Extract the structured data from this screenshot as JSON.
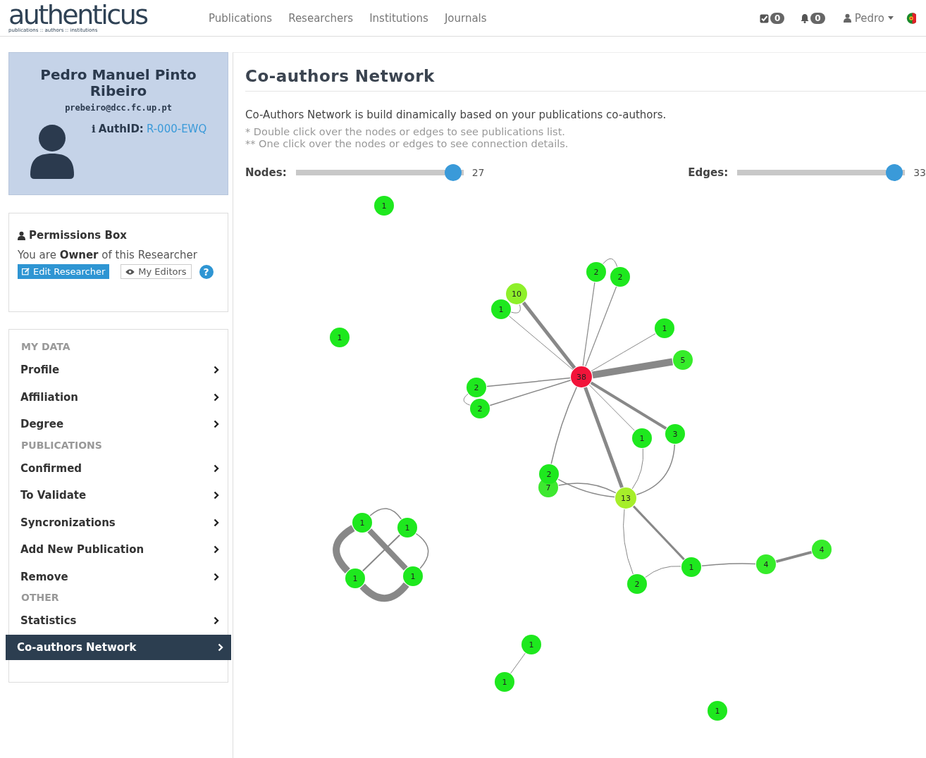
{
  "header": {
    "logo": "authenticus",
    "logo_tagline": "publications :: authors :: institutions",
    "nav": [
      {
        "label": "Publications"
      },
      {
        "label": "Researchers"
      },
      {
        "label": "Institutions"
      },
      {
        "label": "Journals"
      }
    ],
    "tasks_count": "0",
    "notifications_count": "0",
    "user": "Pedro"
  },
  "profile": {
    "name": "Pedro Manuel Pinto Ribeiro",
    "email": "prebeiro@dcc.fc.up.pt",
    "info_glyph": "i",
    "authid_label": "AuthID:",
    "authid": "R-000-EWQ"
  },
  "permissions": {
    "title": "Permissions Box",
    "text": "You are **Owner** of this Researcher",
    "edit_button": "Edit Researcher",
    "editors_button": "My Editors",
    "help": "?"
  },
  "menu": [
    {
      "title": "MY DATA",
      "items": [
        {
          "label": "Profile",
          "selected": false
        },
        {
          "label": "Affiliation",
          "selected": false
        },
        {
          "label": "Degree",
          "selected": false
        }
      ]
    },
    {
      "title": "PUBLICATIONS",
      "items": [
        {
          "label": "Confirmed",
          "selected": false
        },
        {
          "label": "To Validate",
          "selected": false
        },
        {
          "label": "Syncronizations",
          "selected": false
        },
        {
          "label": "Add New Publication",
          "selected": false
        },
        {
          "label": "Remove",
          "selected": false
        }
      ]
    },
    {
      "title": "OTHER",
      "items": [
        {
          "label": "Statistics",
          "selected": false
        },
        {
          "label": "Co-authors Network",
          "selected": true
        }
      ]
    }
  ],
  "main": {
    "title": "Co-authors Network",
    "description": "Co-Authors Network is build dinamically based on your publications co-authors.",
    "notes": [
      "* Double click over the nodes or edges to see publications list.",
      "** One click over the nodes or edges to see connection details."
    ],
    "sliders": [
      {
        "label": "Nodes:",
        "level": 0.96,
        "value": "27"
      },
      {
        "label": "Edges:",
        "level": 0.96,
        "value": "33"
      }
    ],
    "graph_nodes": [
      {
        "label": "1",
        "color": "#1ee81e"
      },
      {
        "label": "1",
        "color": "#1ee81e"
      },
      {
        "label": "10",
        "color": "#8ef02a"
      },
      {
        "label": "1",
        "color": "#1ee81e"
      },
      {
        "label": "2",
        "color": "#1ee81e"
      },
      {
        "label": "2",
        "color": "#1ee81e"
      },
      {
        "label": "1",
        "color": "#1ee81e"
      },
      {
        "label": "5",
        "color": "#36ec2a"
      },
      {
        "label": "38",
        "color": "#f2143a"
      },
      {
        "label": "2",
        "color": "#1ee81e"
      },
      {
        "label": "2",
        "color": "#1ee81e"
      },
      {
        "label": "1",
        "color": "#1ee81e"
      },
      {
        "label": "3",
        "color": "#1ee81e"
      },
      {
        "label": "7",
        "color": "#3ee830"
      },
      {
        "label": "2",
        "color": "#1ee81e"
      },
      {
        "label": "13",
        "color": "#a6ee2a"
      },
      {
        "label": "1",
        "color": "#1ee81e"
      },
      {
        "label": "1",
        "color": "#1ee81e"
      },
      {
        "label": "1",
        "color": "#1ee81e"
      },
      {
        "label": "1",
        "color": "#1ee81e"
      },
      {
        "label": "1",
        "color": "#1ee81e"
      },
      {
        "label": "2",
        "color": "#1ee81e"
      },
      {
        "label": "4",
        "color": "#36ec2a"
      },
      {
        "label": "4",
        "color": "#36ec2a"
      },
      {
        "label": "1",
        "color": "#1ee81e"
      },
      {
        "label": "1",
        "color": "#1ee81e"
      },
      {
        "label": "1",
        "color": "#1ee81e"
      }
    ]
  }
}
